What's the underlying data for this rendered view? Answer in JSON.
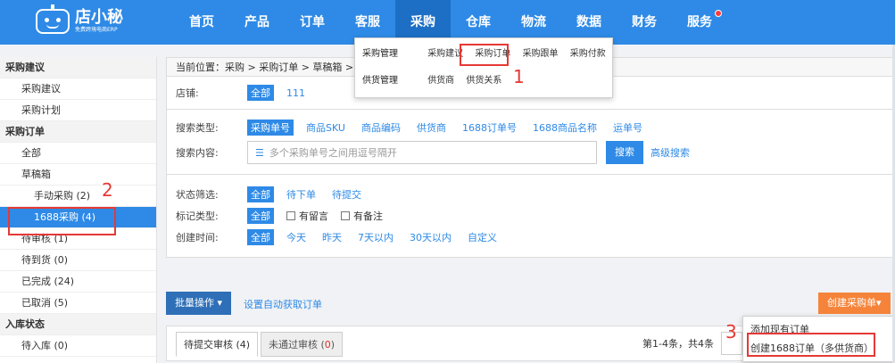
{
  "logo": {
    "name": "店小秘",
    "subtitle": "免费跨境电商ERP"
  },
  "nav": {
    "items": [
      "首页",
      "产品",
      "订单",
      "客服",
      "采购",
      "仓库",
      "物流",
      "数据",
      "财务",
      "服务"
    ],
    "active": "采购"
  },
  "purchase_menu": {
    "group1": "采购管理",
    "group1_links": [
      "采购建议",
      "采购订单",
      "采购跟单",
      "采购付款"
    ],
    "group2": "供货管理",
    "group2_links": [
      "供货商",
      "供货关系"
    ]
  },
  "sidebar": {
    "items": [
      {
        "label": "采购建议",
        "type": "head"
      },
      {
        "label": "采购建议",
        "type": "group"
      },
      {
        "label": "采购计划",
        "type": "group"
      },
      {
        "label": "采购订单",
        "type": "head"
      },
      {
        "label": "全部",
        "type": "group"
      },
      {
        "label": "草稿箱",
        "type": "group"
      },
      {
        "label": "手动采购 (2)",
        "type": "sub"
      },
      {
        "label": "1688采购 (4)",
        "type": "sub-active"
      },
      {
        "label": "待审核 (1)",
        "type": "group"
      },
      {
        "label": "待到货 (0)",
        "type": "group"
      },
      {
        "label": "已完成 (24)",
        "type": "group"
      },
      {
        "label": "已取消 (5)",
        "type": "group"
      },
      {
        "label": "入库状态",
        "type": "head"
      },
      {
        "label": "待入库 (0)",
        "type": "group"
      }
    ]
  },
  "breadcrumb": "当前位置：采购 > 采购订单 > 草稿箱 > ",
  "filters": {
    "store_label": "店铺:",
    "store_options": [
      "全部",
      "111"
    ],
    "search_type_label": "搜索类型:",
    "search_types": [
      "采购单号",
      "商品SKU",
      "商品编码",
      "供货商",
      "1688订单号",
      "1688商品名称",
      "运单号"
    ],
    "search_content_label": "搜索内容:",
    "search_placeholder": "多个采购单号之间用逗号隔开",
    "search_button": "搜索",
    "advanced_search": "高级搜索",
    "status_label": "状态筛选:",
    "status_options": [
      "全部",
      "待下单",
      "待提交"
    ],
    "mark_label": "标记类型:",
    "mark_all": "全部",
    "mark_checks": [
      "有留言",
      "有备注"
    ],
    "created_label": "创建时间:",
    "created_options": [
      "全部",
      "今天",
      "昨天",
      "7天以内",
      "30天以内",
      "自定义"
    ]
  },
  "toolbar": {
    "batch": "批量操作 ▾",
    "auto_fetch": "设置自动获取订单",
    "create": "创建采购单▾"
  },
  "tabs": {
    "pending_label": "待提交审核 (4)",
    "rejected_label": "未通过审核 (",
    "rejected_count": "0",
    "rejected_close": ")"
  },
  "pager": "第1-4条，共4条",
  "create_menu": [
    "添加现有订单",
    "创建1688订单（多供货商）"
  ],
  "annotations": [
    "1",
    "2",
    "3"
  ],
  "colors": {
    "primary": "#2e8ae6",
    "orange": "#f5843a",
    "highlight": "#e53935"
  }
}
